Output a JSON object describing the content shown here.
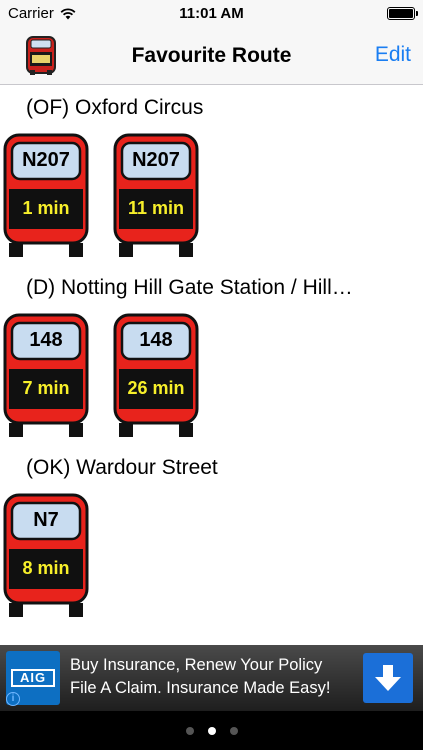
{
  "status_bar": {
    "carrier": "Carrier",
    "time": "11:01 AM"
  },
  "nav": {
    "title": "Favourite Route",
    "edit_label": "Edit"
  },
  "colors": {
    "bus_red": "#e8231c",
    "window_blue": "#c8dcf0",
    "eta_yellow": "#f7ef2a",
    "accent_blue": "#1a7ef2"
  },
  "stops": [
    {
      "name": "(OF) Oxford Circus",
      "buses": [
        {
          "route": "N207",
          "eta": "1 min"
        },
        {
          "route": "N207",
          "eta": "11 min"
        }
      ]
    },
    {
      "name": "(D) Notting Hill Gate Station  / Hill…",
      "buses": [
        {
          "route": "148",
          "eta": "7 min"
        },
        {
          "route": "148",
          "eta": "26 min"
        }
      ]
    },
    {
      "name": "(OK) Wardour Street",
      "buses": [
        {
          "route": "N7",
          "eta": "8 min"
        }
      ]
    }
  ],
  "ad": {
    "logo_text": "AIG",
    "line1": "Buy Insurance, Renew Your Policy",
    "line2": "File A Claim. Insurance Made Easy!",
    "info_icon": "i"
  },
  "page_control": {
    "count": 3,
    "active_index": 1
  }
}
